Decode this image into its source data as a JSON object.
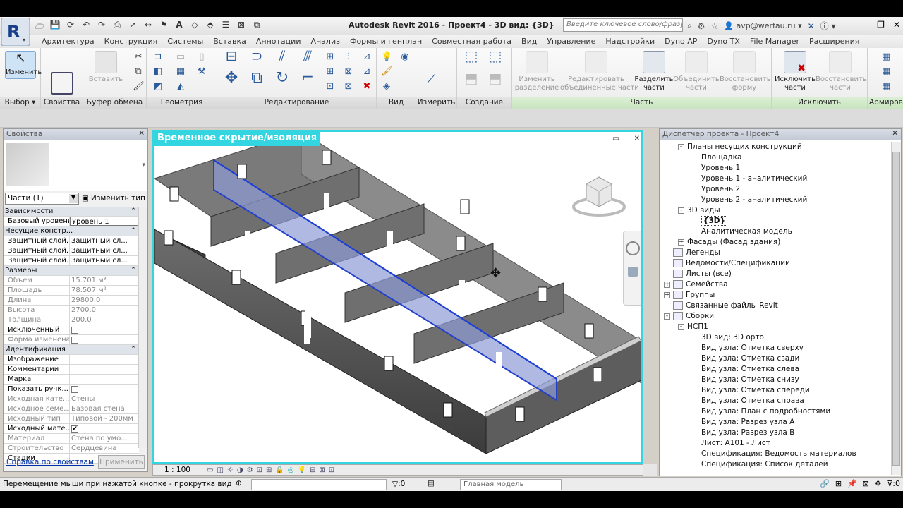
{
  "app": {
    "title": "Autodesk Revit 2016 -   Проект4 - 3D вид: {3D}",
    "search_placeholder": "Введите ключевое слово/фразу",
    "user": "avp@werfau.ru"
  },
  "menu_tabs": [
    "Архитектура",
    "Конструкция",
    "Системы",
    "Вставка",
    "Аннотации",
    "Анализ",
    "Формы и генплан",
    "Совместная работа",
    "Вид",
    "Управление",
    "Надстройки",
    "Dyno AP",
    "Dyno TX",
    "File Manager",
    "Расширения"
  ],
  "ribbon": {
    "modify": {
      "label": "Изменить",
      "panel": "Выбор"
    },
    "properties": {
      "panel": "Свойства"
    },
    "clipboard": {
      "paste": "Вставить",
      "panel": "Буфер обмена"
    },
    "geometry": {
      "panel": "Геометрия"
    },
    "edit": {
      "panel": "Редактирование"
    },
    "view": {
      "panel": "Вид"
    },
    "measure": {
      "panel": "Измерить"
    },
    "create": {
      "panel": "Создание"
    },
    "part": {
      "panel": "Часть",
      "b1": "Изменить\nразделение",
      "b2": "Редактировать\nобъединенные части",
      "b3": "Разделить\nчасти",
      "b4": "Объединить\nчасти",
      "b5": "Восстановить\nформу"
    },
    "exclude": {
      "panel": "Исключить",
      "b1": "Исключить\nчасти",
      "b2": "Восстановить\nчасти"
    },
    "armor": {
      "panel": "Армирова"
    }
  },
  "properties": {
    "title": "Свойства",
    "type": "Части (1)",
    "edit_type": "Изменить тип",
    "rows": [
      {
        "g": true,
        "k": "Зависимости"
      },
      {
        "k": "Базовый уровень",
        "v": "Уровень 1"
      },
      {
        "g": true,
        "k": "Несущие констр..."
      },
      {
        "k": "Защитный слой...",
        "v": "Защитный сл..."
      },
      {
        "k": "Защитный слой...",
        "v": "Защитный сл..."
      },
      {
        "k": "Защитный слой...",
        "v": "Защитный сл..."
      },
      {
        "g": true,
        "k": "Размеры"
      },
      {
        "k": "Объем",
        "v": "15.701 м³",
        "gray": true
      },
      {
        "k": "Площадь",
        "v": "78.507 м²",
        "gray": true
      },
      {
        "k": "Длина",
        "v": "29800.0",
        "gray": true
      },
      {
        "k": "Высота",
        "v": "2700.0",
        "gray": true
      },
      {
        "k": "Толщина",
        "v": "200.0",
        "gray": true
      },
      {
        "k": "Исключенный",
        "chk": ""
      },
      {
        "k": "Форма изменена",
        "chk": "",
        "gray": true
      },
      {
        "g": true,
        "k": "Идентификация"
      },
      {
        "k": "Изображение",
        "v": ""
      },
      {
        "k": "Комментарии",
        "v": ""
      },
      {
        "k": "Марка",
        "v": ""
      },
      {
        "k": "Показать ручк...",
        "chk": ""
      },
      {
        "k": "Исходная кате...",
        "v": "Стены",
        "gray": true
      },
      {
        "k": "Исходное семе...",
        "v": "Базовая стена",
        "gray": true
      },
      {
        "k": "Исходный тип",
        "v": "Типовой - 200мм",
        "gray": true
      },
      {
        "k": "Исходный мате...",
        "chk": "✔"
      },
      {
        "k": "Материал",
        "v": "Стена по умо...",
        "gray": true
      },
      {
        "k": "Строительство",
        "v": "Сердцевина",
        "gray": true
      },
      {
        "k": "Стадии",
        "v": ""
      }
    ],
    "help": "Справка по свойствам",
    "apply": "Применить"
  },
  "viewport": {
    "title": "Временное скрытие/изоляция",
    "scale": "1 : 100"
  },
  "browser": {
    "title": "Диспетчер проекта - Проект4",
    "nodes": [
      {
        "t": "Планы несущих конструкций",
        "l": 1,
        "e": "-"
      },
      {
        "t": "Площадка",
        "l": 2
      },
      {
        "t": "Уровень 1",
        "l": 2
      },
      {
        "t": "Уровень 1 - аналитический",
        "l": 2
      },
      {
        "t": "Уровень 2",
        "l": 2
      },
      {
        "t": "Уровень 2 - аналитический",
        "l": 2
      },
      {
        "t": "3D виды",
        "l": 1,
        "e": "-"
      },
      {
        "t": "{3D}",
        "l": 2,
        "sel": true
      },
      {
        "t": "Аналитическая модель",
        "l": 2
      },
      {
        "t": "Фасады (Фасад здания)",
        "l": 1,
        "e": "+"
      },
      {
        "t": "Легенды",
        "l": 0,
        "i": true
      },
      {
        "t": "Ведомости/Спецификации",
        "l": 0,
        "i": true
      },
      {
        "t": "Листы (все)",
        "l": 0,
        "i": true
      },
      {
        "t": "Семейства",
        "l": 0,
        "e": "+",
        "i": true
      },
      {
        "t": "Группы",
        "l": 0,
        "e": "+",
        "i": true
      },
      {
        "t": "Связанные файлы Revit",
        "l": 0,
        "i": true
      },
      {
        "t": "Сборки",
        "l": 0,
        "e": "-",
        "i": true
      },
      {
        "t": "НСП1",
        "l": 1,
        "e": "-"
      },
      {
        "t": "3D вид: 3D орто",
        "l": 2
      },
      {
        "t": "Вид узла: Отметка сверху",
        "l": 2
      },
      {
        "t": "Вид узла: Отметка сзади",
        "l": 2
      },
      {
        "t": "Вид узла: Отметка слева",
        "l": 2
      },
      {
        "t": "Вид узла: Отметка снизу",
        "l": 2
      },
      {
        "t": "Вид узла: Отметка спереди",
        "l": 2
      },
      {
        "t": "Вид узла: Отметка справа",
        "l": 2
      },
      {
        "t": "Вид узла: План с подробностями",
        "l": 2
      },
      {
        "t": "Вид узла: Разрез узла А",
        "l": 2
      },
      {
        "t": "Вид узла: Разрез узла B",
        "l": 2
      },
      {
        "t": "Лист: A101 - Лист",
        "l": 2
      },
      {
        "t": "Спецификация: Ведомость материалов",
        "l": 2
      },
      {
        "t": "Спецификация: Список деталей",
        "l": 2
      }
    ]
  },
  "status": {
    "message": "Перемещение мыши при нажатой кнопке - прокрутка вида, Ctrl - зу",
    "count": ":0",
    "model": "Главная модель"
  }
}
